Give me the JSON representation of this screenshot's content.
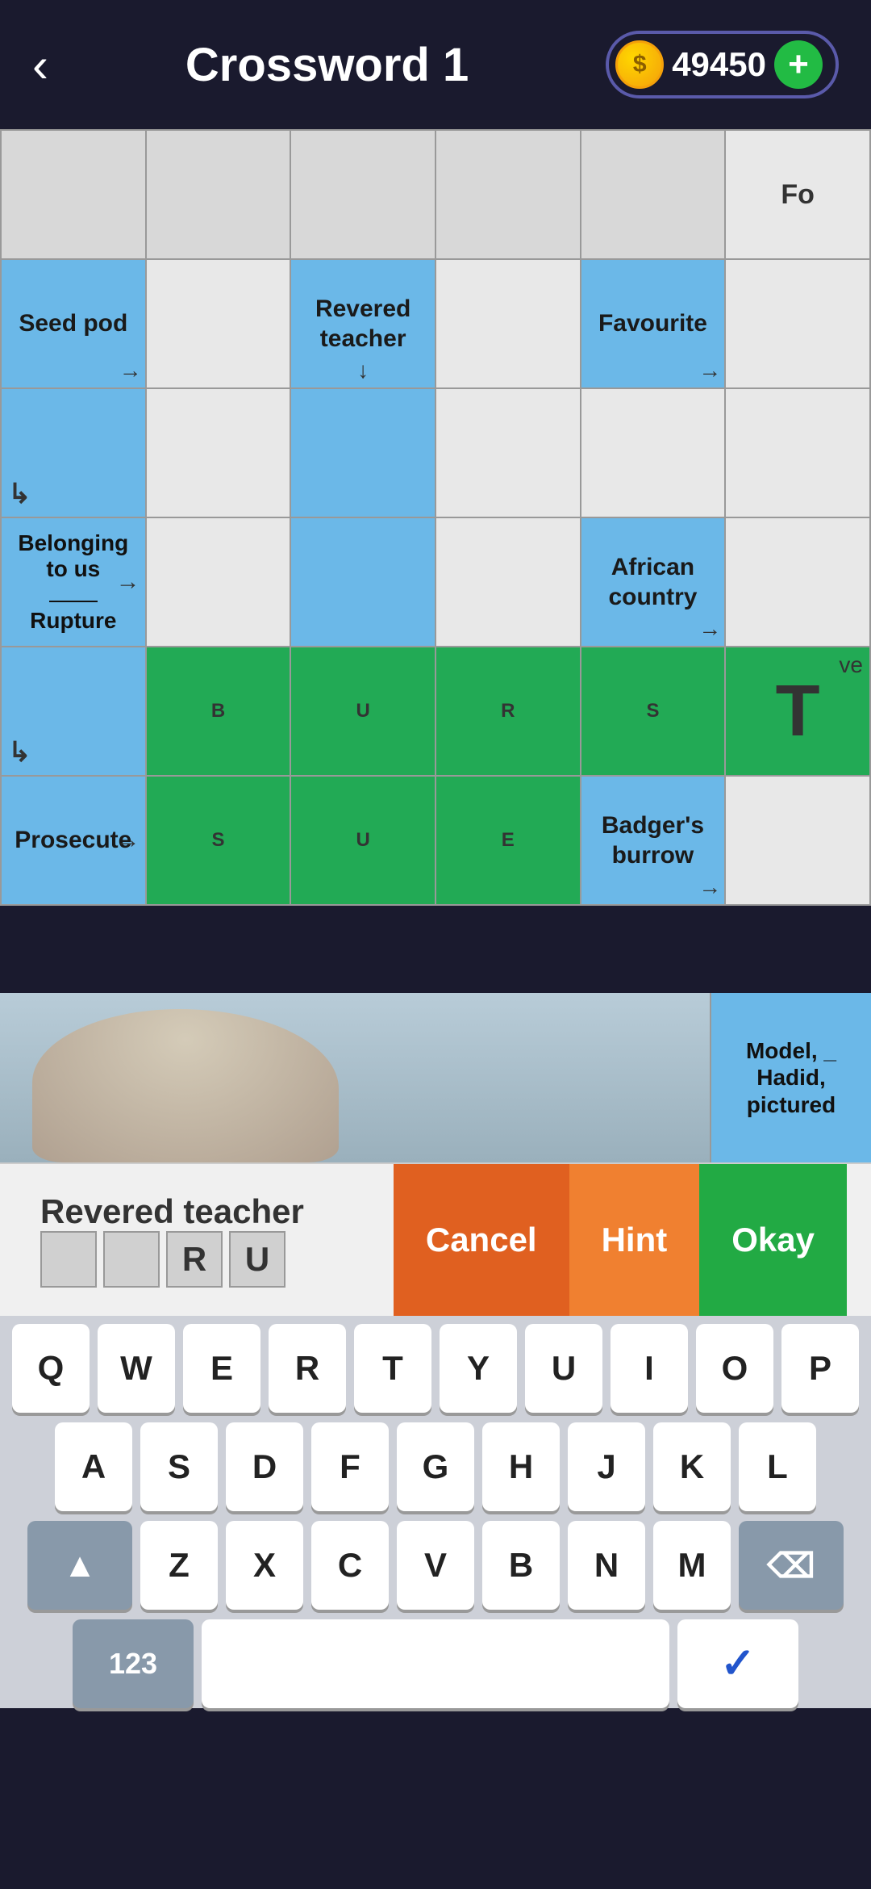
{
  "header": {
    "back_label": "‹",
    "title": "Crossword 1",
    "coins": "49450",
    "plus_label": "+"
  },
  "grid": {
    "rows": [
      [
        {
          "type": "empty",
          "text": ""
        },
        {
          "type": "empty",
          "text": ""
        },
        {
          "type": "empty",
          "text": ""
        },
        {
          "type": "empty",
          "text": ""
        },
        {
          "type": "empty",
          "text": ""
        },
        {
          "type": "white",
          "text": "Fo"
        }
      ],
      [
        {
          "type": "clue",
          "text": "Seed pod",
          "arrow": "right"
        },
        {
          "type": "white",
          "text": ""
        },
        {
          "type": "clue",
          "text": "Revered teacher",
          "arrow": "down"
        },
        {
          "type": "white",
          "text": ""
        },
        {
          "type": "clue",
          "text": "Favourite",
          "arrow": "right"
        },
        {
          "type": "white",
          "text": ""
        }
      ],
      [
        {
          "type": "clue-corner",
          "text": "",
          "arrow": "corner"
        },
        {
          "type": "white",
          "text": ""
        },
        {
          "type": "blue",
          "text": ""
        },
        {
          "type": "white",
          "text": ""
        },
        {
          "type": "white",
          "text": ""
        },
        {
          "type": "white",
          "text": ""
        }
      ],
      [
        {
          "type": "clue-multi",
          "line1": "Belonging",
          "line2": "to us",
          "line3": "—",
          "line4": "Rupture",
          "arrow": "right"
        },
        {
          "type": "white",
          "text": ""
        },
        {
          "type": "blue",
          "text": ""
        },
        {
          "type": "white",
          "text": ""
        },
        {
          "type": "clue",
          "text": "African country",
          "arrow": "right"
        },
        {
          "type": "white",
          "text": ""
        }
      ],
      [
        {
          "type": "clue-corner2",
          "text": "",
          "arrow": "corner"
        },
        {
          "type": "green",
          "letter": "B"
        },
        {
          "type": "green",
          "letter": "U"
        },
        {
          "type": "green",
          "letter": "R"
        },
        {
          "type": "green",
          "letter": "S"
        },
        {
          "type": "green-partial",
          "letter": "T",
          "text": "ve"
        }
      ],
      [
        {
          "type": "clue",
          "text": "Prosecute",
          "arrow": "right"
        },
        {
          "type": "green",
          "letter": "S"
        },
        {
          "type": "green",
          "letter": "U"
        },
        {
          "type": "green",
          "letter": "E"
        },
        {
          "type": "clue",
          "text": "Badger's burrow",
          "arrow": "right"
        },
        {
          "type": "white",
          "text": ""
        }
      ]
    ]
  },
  "image_row": {
    "has_image": true,
    "clue_right": "Model, _ Hadid, pictured"
  },
  "clue_bar": {
    "label": "Revered teacher",
    "boxes": [
      {
        "value": "",
        "filled": false
      },
      {
        "value": "",
        "filled": false
      },
      {
        "value": "R",
        "filled": true
      },
      {
        "value": "U",
        "filled": true
      }
    ],
    "cancel": "Cancel",
    "hint": "Hint",
    "okay": "Okay"
  },
  "keyboard": {
    "rows": [
      [
        "Q",
        "W",
        "E",
        "R",
        "T",
        "Y",
        "U",
        "I",
        "O",
        "P"
      ],
      [
        "A",
        "S",
        "D",
        "F",
        "G",
        "H",
        "J",
        "K",
        "L"
      ],
      [
        "SHIFT",
        "Z",
        "X",
        "C",
        "V",
        "B",
        "N",
        "M",
        "DELETE"
      ]
    ],
    "bottom_left": "123",
    "bottom_right": "✓"
  }
}
